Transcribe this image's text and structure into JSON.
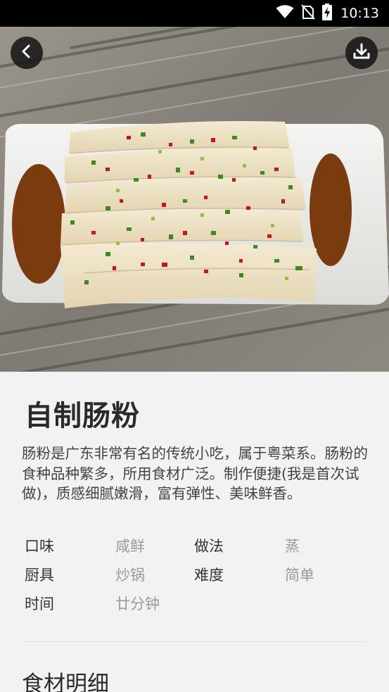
{
  "status_bar": {
    "time": "10:13",
    "icons": [
      "wifi-icon",
      "no-sim-icon",
      "battery-charging-icon"
    ]
  },
  "header": {
    "back_icon": "chevron-left-icon",
    "download_icon": "download-icon"
  },
  "recipe": {
    "title": "自制肠粉",
    "description": "肠粉是广东非常有名的传统小吃，属于粤菜系。肠粉的食种品种繁多，所用食材广泛。制作便捷(我是首次试做)，质感细腻嫩滑，富有弹性、美味鲜香。",
    "attributes": {
      "taste_label": "口味",
      "taste_value": "咸鲜",
      "method_label": "做法",
      "method_value": "蒸",
      "tool_label": "厨具",
      "tool_value": "炒锅",
      "difficulty_label": "难度",
      "difficulty_value": "简单",
      "time_label": "时间",
      "time_value": "廿分钟"
    }
  },
  "ingredients": {
    "section_title": "食材明细"
  }
}
